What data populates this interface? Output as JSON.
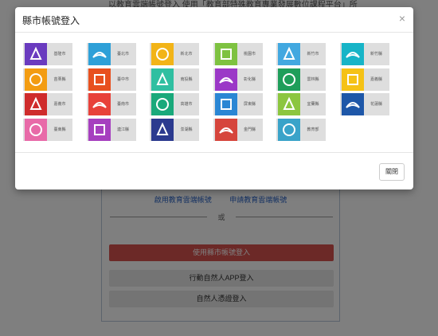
{
  "background": {
    "top_text": "以教育雲端帳號登入 使用「教育部特殊教育專業發展數位課程平台」所",
    "links": [
      "啟用教育雲端帳號",
      "申請教育雲端帳號"
    ],
    "or_label": "或",
    "btn_county": "使用縣市帳號登入",
    "btn_app": "行動自然人APP登入",
    "btn_cert": "自然人憑證登入"
  },
  "modal": {
    "title": "縣市帳號登入",
    "close_symbol": "×",
    "close_button_label": "關閉"
  },
  "counties": [
    {
      "name": "基隆市",
      "color": "#6a3bbf",
      "icon": "keelung-icon"
    },
    {
      "name": "臺北市",
      "color": "#2ea0d8",
      "icon": "taipei-icon"
    },
    {
      "name": "新北市",
      "color": "#f2b418",
      "icon": "newtaipei-icon"
    },
    {
      "name": "桃園市",
      "color": "#7ec241",
      "icon": "taoyuan-icon"
    },
    {
      "name": "新竹市",
      "color": "#42a8e0",
      "icon": "hsinchu-city-icon"
    },
    {
      "name": "新竹縣",
      "color": "#17b4c7",
      "icon": "hsinchu-county-icon"
    },
    {
      "name": "苗栗縣",
      "color": "#f39c12",
      "icon": "miaoli-icon"
    },
    {
      "name": "臺中市",
      "color": "#e8501f",
      "icon": "taichung-icon"
    },
    {
      "name": "南投縣",
      "color": "#2fbfa1",
      "icon": "nantou-icon"
    },
    {
      "name": "彰化縣",
      "color": "#9b38c7",
      "icon": "changhua-icon"
    },
    {
      "name": "雲林縣",
      "color": "#1e9e5a",
      "icon": "yunlin-icon"
    },
    {
      "name": "嘉義縣",
      "color": "#f5c216",
      "icon": "chiayi-county-icon"
    },
    {
      "name": "嘉義市",
      "color": "#cf2b2b",
      "icon": "chiayi-city-icon"
    },
    {
      "name": "臺南市",
      "color": "#e8413a",
      "icon": "tainan-icon"
    },
    {
      "name": "高雄市",
      "color": "#19a97b",
      "icon": "kaohsiung-icon"
    },
    {
      "name": "屏東縣",
      "color": "#2a86d4",
      "icon": "pingtung-icon"
    },
    {
      "name": "宜蘭縣",
      "color": "#8cc63f",
      "icon": "yilan-icon"
    },
    {
      "name": "花蓮縣",
      "color": "#1e57a8",
      "icon": "hualien-icon"
    },
    {
      "name": "臺東縣",
      "color": "#e86aa8",
      "icon": "taitung-icon"
    },
    {
      "name": "連江縣",
      "color": "#a63fbf",
      "icon": "lienchiang-icon"
    },
    {
      "name": "澎湖縣",
      "color": "#2b3a8f",
      "icon": "penghu-icon"
    },
    {
      "name": "金門縣",
      "color": "#d6453c",
      "icon": "kinmen-icon"
    },
    {
      "name": "教育部",
      "color": "#3aa3c9",
      "icon": "moe-icon"
    }
  ]
}
